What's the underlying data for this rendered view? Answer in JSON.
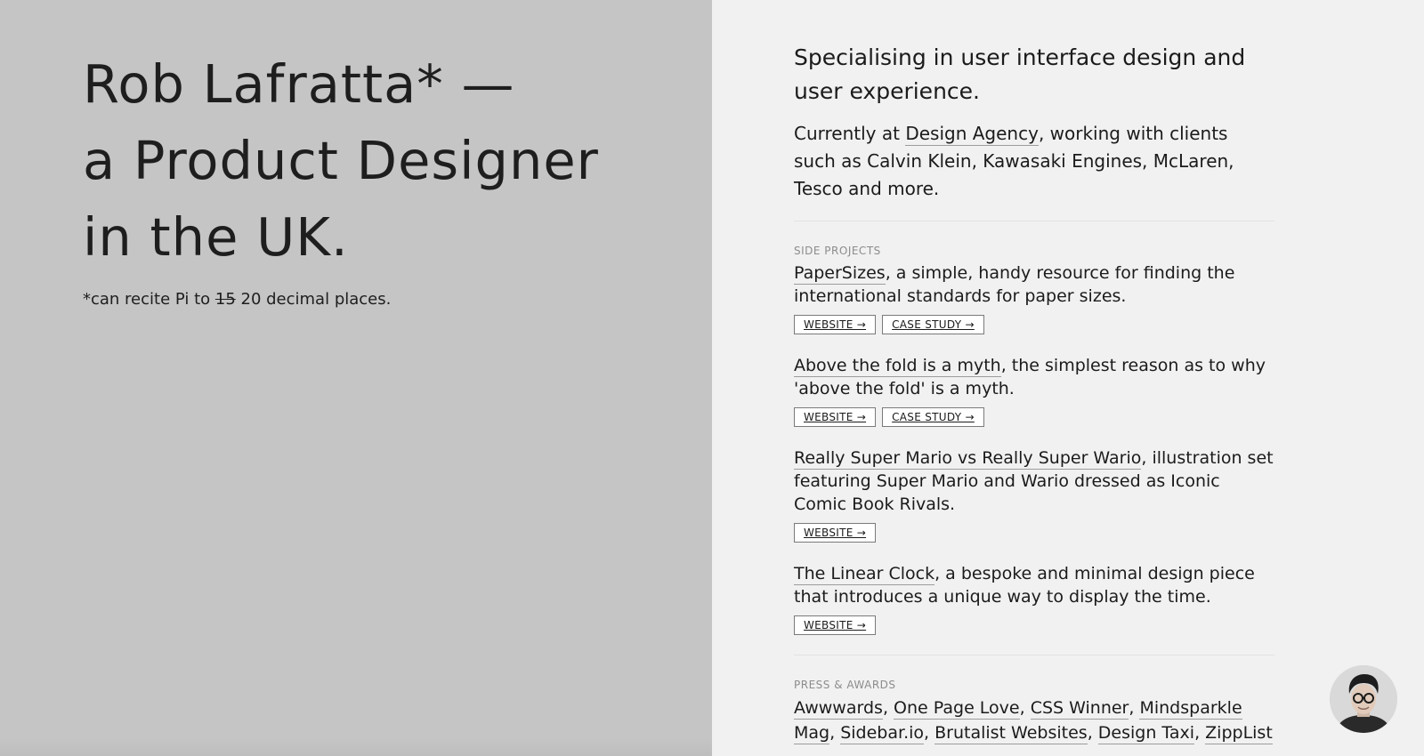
{
  "hero": {
    "line1": "Rob Lafratta* —",
    "line2": "a Product Designer",
    "line3": "in the UK.",
    "footnote_prefix": "*can recite Pi to ",
    "footnote_strike": "15",
    "footnote_suffix": " 20 decimal places."
  },
  "intro": {
    "text": "Specialising in user interface design and user experience."
  },
  "current": {
    "prefix": "Currently at ",
    "agency": "Design Agency",
    "suffix": ", working with clients such as Calvin Klein, Kawasaki Engines, McLaren, Tesco and more."
  },
  "side_projects": {
    "label": "SIDE PROJECTS",
    "items": [
      {
        "title": "PaperSizes",
        "desc": ", a simple, handy resource for finding the international standards for paper sizes.",
        "website": "WEBSITE →",
        "case_study": "CASE STUDY →"
      },
      {
        "title": "Above the fold is a myth",
        "desc": ", the simplest reason as to why 'above the fold' is a myth.",
        "website": "WEBSITE →",
        "case_study": "CASE STUDY →"
      },
      {
        "title": "Really Super Mario vs Really Super Wario",
        "desc": ", illustration set featuring Super Mario and Wario dressed as Iconic Comic Book Rivals.",
        "website": "WEBSITE →"
      },
      {
        "title": "The Linear Clock",
        "desc": ", a bespoke and minimal design piece that introduces a unique way to display the time.",
        "website": "WEBSITE →"
      }
    ]
  },
  "press": {
    "label": "PRESS & AWARDS",
    "items": [
      "Awwwards",
      "One Page Love",
      "CSS Winner",
      "Mindsparkle Mag",
      "Sidebar.io",
      "Brutalist Websites",
      "Design Taxi",
      "ZippList"
    ],
    "sep": ", "
  },
  "colors": {
    "left_bg": "#c5c5c5",
    "right_bg": "#f1f1f1",
    "text": "#1b1b1b"
  },
  "icons": {
    "avatar": "avatar-icon"
  }
}
